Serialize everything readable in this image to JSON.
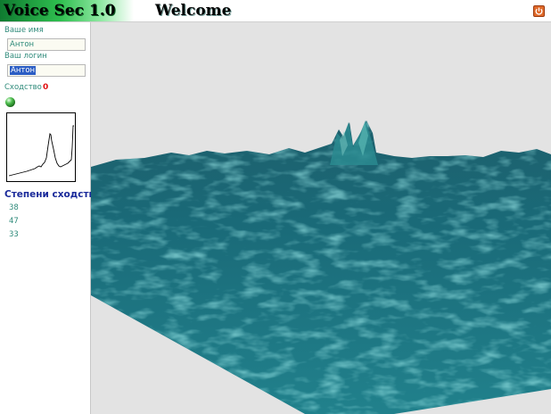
{
  "header": {
    "app_title": "Voice Sec 1.0",
    "welcome": "Welcome",
    "power_icon": "power-icon"
  },
  "sidebar": {
    "name_label": "Ваше имя",
    "name_value": "Антон",
    "login_label": "Ваш логин",
    "login_value": "Антон",
    "similarity_label": "Сходство",
    "similarity_value": "0",
    "status_icon": "green-ball-icon",
    "degrees_title": "Степени сходства",
    "degrees": [
      "38",
      "47",
      "33"
    ]
  },
  "colors": {
    "title_green": "#1fa040",
    "label_teal": "#2e8a7a",
    "similarity_red": "#e01010",
    "degrees_blue": "#1a2a9a",
    "surface_teal": "#1f6f7c",
    "viewport_gray": "#e3e3e3"
  }
}
